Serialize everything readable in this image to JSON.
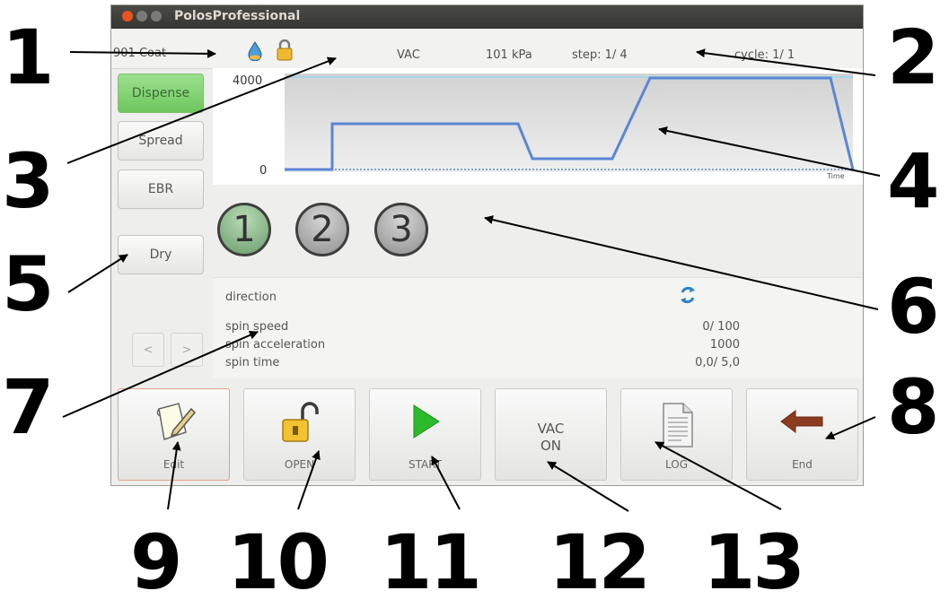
{
  "window": {
    "title": "PolosProfessional"
  },
  "status": {
    "program": "901 Coat",
    "mode": "VAC",
    "pressure": "101 kPa",
    "step": "step: 1/ 4",
    "cycle": "cycle: 1/ 1"
  },
  "sidebar": {
    "items": [
      {
        "label": "Dispense",
        "active": true
      },
      {
        "label": "Spread"
      },
      {
        "label": "EBR"
      },
      {
        "label": "Dry"
      }
    ],
    "prev": "<",
    "next": ">"
  },
  "chart": {
    "ymax": "4000",
    "ymin": "0",
    "xlabel": "Time"
  },
  "steps": [
    "1",
    "2",
    "3"
  ],
  "params": {
    "direction_label": "direction",
    "speed_label": "spin speed",
    "speed_value": "0/ 100",
    "accel_label": "spin acceleration",
    "accel_value": "1000",
    "time_label": "spin time",
    "time_value": "0,0/ 5,0"
  },
  "buttons": {
    "edit": "Edit",
    "open": "OPEN",
    "start": "START",
    "vac_line1": "VAC",
    "vac_line2": "ON",
    "log": "LOG",
    "end": "End"
  },
  "callouts": [
    "1",
    "2",
    "3",
    "4",
    "5",
    "6",
    "7",
    "8",
    "9",
    "10",
    "11",
    "12",
    "13"
  ],
  "colors": {
    "active_green": "#6fc75d",
    "curve_blue": "#5b86d6",
    "start_green": "#2dbb2d",
    "end_arrow": "#8b3b1f"
  }
}
